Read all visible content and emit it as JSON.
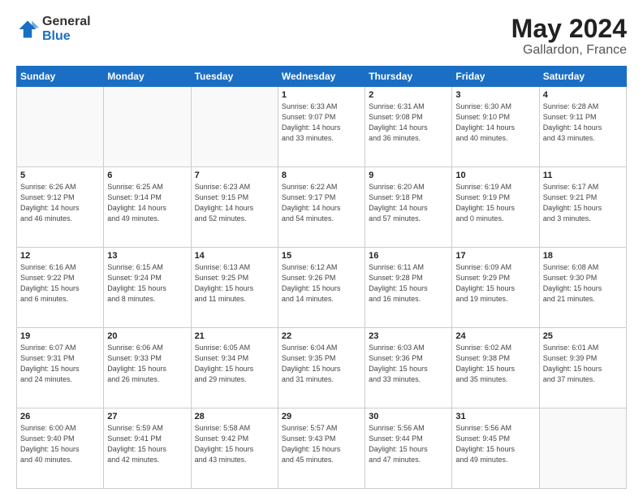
{
  "header": {
    "logo_general": "General",
    "logo_blue": "Blue",
    "month_title": "May 2024",
    "location": "Gallardon, France"
  },
  "days_of_week": [
    "Sunday",
    "Monday",
    "Tuesday",
    "Wednesday",
    "Thursday",
    "Friday",
    "Saturday"
  ],
  "weeks": [
    [
      {
        "day": "",
        "info": ""
      },
      {
        "day": "",
        "info": ""
      },
      {
        "day": "",
        "info": ""
      },
      {
        "day": "1",
        "info": "Sunrise: 6:33 AM\nSunset: 9:07 PM\nDaylight: 14 hours\nand 33 minutes."
      },
      {
        "day": "2",
        "info": "Sunrise: 6:31 AM\nSunset: 9:08 PM\nDaylight: 14 hours\nand 36 minutes."
      },
      {
        "day": "3",
        "info": "Sunrise: 6:30 AM\nSunset: 9:10 PM\nDaylight: 14 hours\nand 40 minutes."
      },
      {
        "day": "4",
        "info": "Sunrise: 6:28 AM\nSunset: 9:11 PM\nDaylight: 14 hours\nand 43 minutes."
      }
    ],
    [
      {
        "day": "5",
        "info": "Sunrise: 6:26 AM\nSunset: 9:12 PM\nDaylight: 14 hours\nand 46 minutes."
      },
      {
        "day": "6",
        "info": "Sunrise: 6:25 AM\nSunset: 9:14 PM\nDaylight: 14 hours\nand 49 minutes."
      },
      {
        "day": "7",
        "info": "Sunrise: 6:23 AM\nSunset: 9:15 PM\nDaylight: 14 hours\nand 52 minutes."
      },
      {
        "day": "8",
        "info": "Sunrise: 6:22 AM\nSunset: 9:17 PM\nDaylight: 14 hours\nand 54 minutes."
      },
      {
        "day": "9",
        "info": "Sunrise: 6:20 AM\nSunset: 9:18 PM\nDaylight: 14 hours\nand 57 minutes."
      },
      {
        "day": "10",
        "info": "Sunrise: 6:19 AM\nSunset: 9:19 PM\nDaylight: 15 hours\nand 0 minutes."
      },
      {
        "day": "11",
        "info": "Sunrise: 6:17 AM\nSunset: 9:21 PM\nDaylight: 15 hours\nand 3 minutes."
      }
    ],
    [
      {
        "day": "12",
        "info": "Sunrise: 6:16 AM\nSunset: 9:22 PM\nDaylight: 15 hours\nand 6 minutes."
      },
      {
        "day": "13",
        "info": "Sunrise: 6:15 AM\nSunset: 9:24 PM\nDaylight: 15 hours\nand 8 minutes."
      },
      {
        "day": "14",
        "info": "Sunrise: 6:13 AM\nSunset: 9:25 PM\nDaylight: 15 hours\nand 11 minutes."
      },
      {
        "day": "15",
        "info": "Sunrise: 6:12 AM\nSunset: 9:26 PM\nDaylight: 15 hours\nand 14 minutes."
      },
      {
        "day": "16",
        "info": "Sunrise: 6:11 AM\nSunset: 9:28 PM\nDaylight: 15 hours\nand 16 minutes."
      },
      {
        "day": "17",
        "info": "Sunrise: 6:09 AM\nSunset: 9:29 PM\nDaylight: 15 hours\nand 19 minutes."
      },
      {
        "day": "18",
        "info": "Sunrise: 6:08 AM\nSunset: 9:30 PM\nDaylight: 15 hours\nand 21 minutes."
      }
    ],
    [
      {
        "day": "19",
        "info": "Sunrise: 6:07 AM\nSunset: 9:31 PM\nDaylight: 15 hours\nand 24 minutes."
      },
      {
        "day": "20",
        "info": "Sunrise: 6:06 AM\nSunset: 9:33 PM\nDaylight: 15 hours\nand 26 minutes."
      },
      {
        "day": "21",
        "info": "Sunrise: 6:05 AM\nSunset: 9:34 PM\nDaylight: 15 hours\nand 29 minutes."
      },
      {
        "day": "22",
        "info": "Sunrise: 6:04 AM\nSunset: 9:35 PM\nDaylight: 15 hours\nand 31 minutes."
      },
      {
        "day": "23",
        "info": "Sunrise: 6:03 AM\nSunset: 9:36 PM\nDaylight: 15 hours\nand 33 minutes."
      },
      {
        "day": "24",
        "info": "Sunrise: 6:02 AM\nSunset: 9:38 PM\nDaylight: 15 hours\nand 35 minutes."
      },
      {
        "day": "25",
        "info": "Sunrise: 6:01 AM\nSunset: 9:39 PM\nDaylight: 15 hours\nand 37 minutes."
      }
    ],
    [
      {
        "day": "26",
        "info": "Sunrise: 6:00 AM\nSunset: 9:40 PM\nDaylight: 15 hours\nand 40 minutes."
      },
      {
        "day": "27",
        "info": "Sunrise: 5:59 AM\nSunset: 9:41 PM\nDaylight: 15 hours\nand 42 minutes."
      },
      {
        "day": "28",
        "info": "Sunrise: 5:58 AM\nSunset: 9:42 PM\nDaylight: 15 hours\nand 43 minutes."
      },
      {
        "day": "29",
        "info": "Sunrise: 5:57 AM\nSunset: 9:43 PM\nDaylight: 15 hours\nand 45 minutes."
      },
      {
        "day": "30",
        "info": "Sunrise: 5:56 AM\nSunset: 9:44 PM\nDaylight: 15 hours\nand 47 minutes."
      },
      {
        "day": "31",
        "info": "Sunrise: 5:56 AM\nSunset: 9:45 PM\nDaylight: 15 hours\nand 49 minutes."
      },
      {
        "day": "",
        "info": ""
      }
    ]
  ]
}
